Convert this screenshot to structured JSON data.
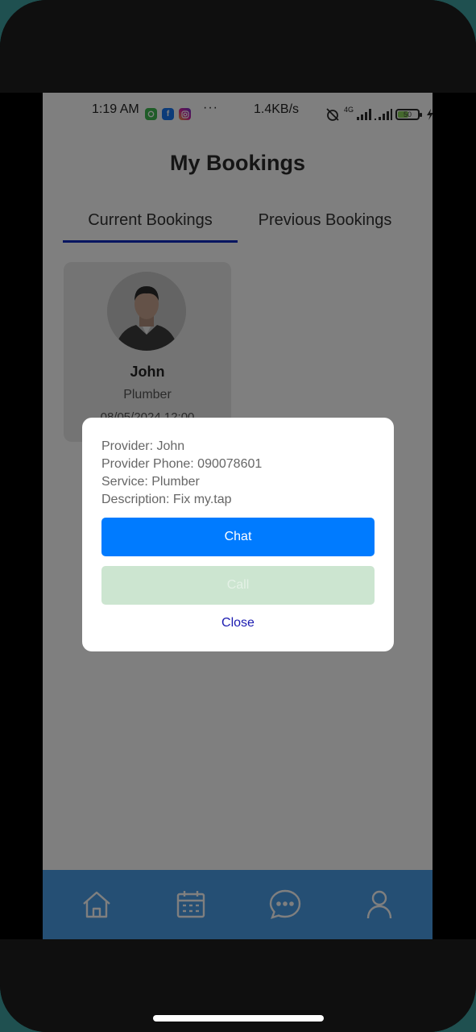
{
  "status_bar": {
    "time": "1:19 AM",
    "more": "···",
    "network_speed": "1.4KB/s",
    "network_type": "4G",
    "battery": "50",
    "app_icons": [
      "messages-icon",
      "facebook-icon",
      "instagram-icon"
    ]
  },
  "page": {
    "title": "My Bookings"
  },
  "tabs": [
    {
      "label": "Current Bookings",
      "active": true
    },
    {
      "label": "Previous Bookings",
      "active": false
    }
  ],
  "booking": {
    "name": "John",
    "service": "Plumber",
    "date": "08/05/2024 12:00"
  },
  "dialog": {
    "provider": "Provider: John",
    "phone": "Provider Phone: 090078601",
    "service": "Service: Plumber",
    "description": "Description: Fix my.tap",
    "chat_label": "Chat",
    "call_label": "Call",
    "close_label": "Close"
  },
  "bottom_nav": {
    "items": [
      "home-icon",
      "calendar-icon",
      "chat-icon",
      "profile-icon"
    ]
  },
  "colors": {
    "primary": "#007bff",
    "call_disabled": "#cce5d0",
    "tab_indicator": "#0a2ac0",
    "nav_bar": "#4a9fe8",
    "close_link": "#1a1ab0"
  }
}
